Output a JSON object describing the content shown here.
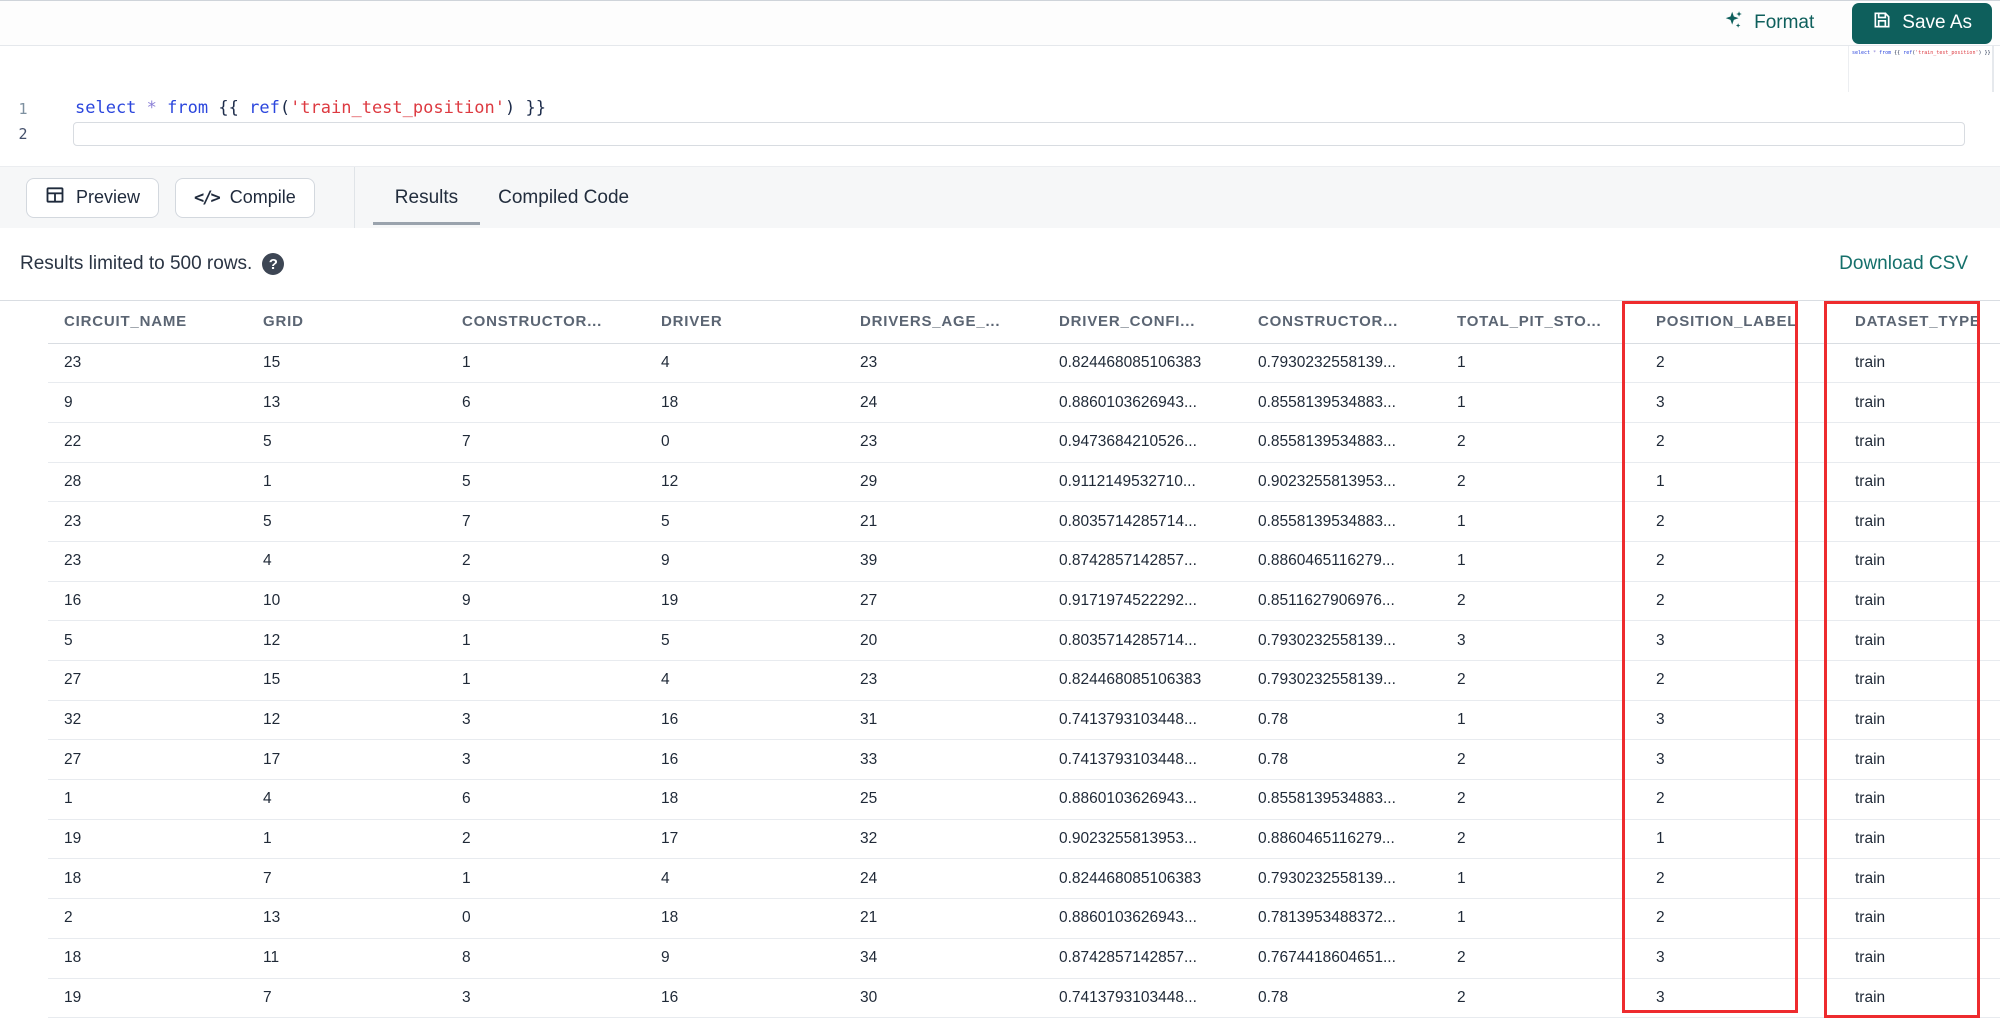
{
  "colors": {
    "accent_teal": "#0e5f5c",
    "link_teal": "#15706b",
    "highlight_red": "#ee2b2e"
  },
  "toolbar": {
    "format_label": "Format",
    "save_as_label": "Save As"
  },
  "editor": {
    "lines": [
      {
        "number": "1"
      },
      {
        "number": "2"
      }
    ],
    "code_tokens": [
      {
        "text": "select",
        "type": "keyword"
      },
      {
        "text": " ",
        "type": "plain"
      },
      {
        "text": "*",
        "type": "operator"
      },
      {
        "text": " ",
        "type": "plain"
      },
      {
        "text": "from",
        "type": "keyword"
      },
      {
        "text": " ",
        "type": "plain"
      },
      {
        "text": "{{ ",
        "type": "brace"
      },
      {
        "text": "ref",
        "type": "function"
      },
      {
        "text": "(",
        "type": "brace"
      },
      {
        "text": "'train_test_position'",
        "type": "string"
      },
      {
        "text": ")",
        "type": "brace"
      },
      {
        "text": " }}",
        "type": "brace"
      }
    ]
  },
  "action_bar": {
    "preview_label": "Preview",
    "compile_label": "Compile",
    "tabs": [
      {
        "label": "Results",
        "active": true
      },
      {
        "label": "Compiled Code",
        "active": false
      }
    ]
  },
  "results": {
    "limit_text": "Results limited to 500 rows.",
    "download_label": "Download CSV"
  },
  "table": {
    "columns": [
      "CIRCUIT_NAME",
      "GRID",
      "CONSTRUCTOR...",
      "DRIVER",
      "DRIVERS_AGE_...",
      "DRIVER_CONFI...",
      "CONSTRUCTOR...",
      "TOTAL_PIT_STO...",
      "POSITION_LABEL",
      "DATASET_TYPE"
    ],
    "highlighted_columns": [
      "POSITION_LABEL",
      "DATASET_TYPE"
    ],
    "rows": [
      [
        "23",
        "15",
        "1",
        "4",
        "23",
        "0.824468085106383",
        "0.7930232558139...",
        "1",
        "2",
        "train"
      ],
      [
        "9",
        "13",
        "6",
        "18",
        "24",
        "0.8860103626943...",
        "0.8558139534883...",
        "1",
        "3",
        "train"
      ],
      [
        "22",
        "5",
        "7",
        "0",
        "23",
        "0.9473684210526...",
        "0.8558139534883...",
        "2",
        "2",
        "train"
      ],
      [
        "28",
        "1",
        "5",
        "12",
        "29",
        "0.9112149532710...",
        "0.9023255813953...",
        "2",
        "1",
        "train"
      ],
      [
        "23",
        "5",
        "7",
        "5",
        "21",
        "0.8035714285714...",
        "0.8558139534883...",
        "1",
        "2",
        "train"
      ],
      [
        "23",
        "4",
        "2",
        "9",
        "39",
        "0.8742857142857...",
        "0.8860465116279...",
        "1",
        "2",
        "train"
      ],
      [
        "16",
        "10",
        "9",
        "19",
        "27",
        "0.9171974522292...",
        "0.8511627906976...",
        "2",
        "2",
        "train"
      ],
      [
        "5",
        "12",
        "1",
        "5",
        "20",
        "0.8035714285714...",
        "0.7930232558139...",
        "3",
        "3",
        "train"
      ],
      [
        "27",
        "15",
        "1",
        "4",
        "23",
        "0.824468085106383",
        "0.7930232558139...",
        "2",
        "2",
        "train"
      ],
      [
        "32",
        "12",
        "3",
        "16",
        "31",
        "0.7413793103448...",
        "0.78",
        "1",
        "3",
        "train"
      ],
      [
        "27",
        "17",
        "3",
        "16",
        "33",
        "0.7413793103448...",
        "0.78",
        "2",
        "3",
        "train"
      ],
      [
        "1",
        "4",
        "6",
        "18",
        "25",
        "0.8860103626943...",
        "0.8558139534883...",
        "2",
        "2",
        "train"
      ],
      [
        "19",
        "1",
        "2",
        "17",
        "32",
        "0.9023255813953...",
        "0.8860465116279...",
        "2",
        "1",
        "train"
      ],
      [
        "18",
        "7",
        "1",
        "4",
        "24",
        "0.824468085106383",
        "0.7930232558139...",
        "1",
        "2",
        "train"
      ],
      [
        "2",
        "13",
        "0",
        "18",
        "21",
        "0.8860103626943...",
        "0.7813953488372...",
        "1",
        "2",
        "train"
      ],
      [
        "18",
        "11",
        "8",
        "9",
        "34",
        "0.8742857142857...",
        "0.7674418604651...",
        "2",
        "3",
        "train"
      ],
      [
        "19",
        "7",
        "3",
        "16",
        "30",
        "0.7413793103448...",
        "0.78",
        "2",
        "3",
        "train"
      ]
    ]
  }
}
